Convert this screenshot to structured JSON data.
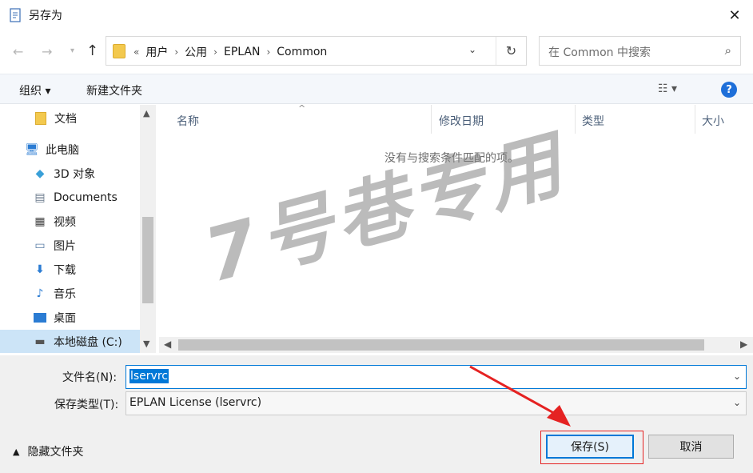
{
  "window": {
    "title": "另存为",
    "close_icon": "close-icon"
  },
  "address": {
    "overflow": "«",
    "crumbs": [
      "用户",
      "公用",
      "EPLAN",
      "Common"
    ]
  },
  "search": {
    "placeholder": "在 Common 中搜索"
  },
  "toolbar": {
    "organize_label": "组织 ▾",
    "new_folder_label": "新建文件夹",
    "view_label": "☷ ▾",
    "help_label": "?"
  },
  "navpane": {
    "items": [
      {
        "label": "文档",
        "icon": "folder-icon"
      },
      {
        "label": "此电脑",
        "icon": "computer-icon"
      },
      {
        "label": "3D 对象",
        "icon": "cube-icon"
      },
      {
        "label": "Documents",
        "icon": "document-icon"
      },
      {
        "label": "视频",
        "icon": "video-icon"
      },
      {
        "label": "图片",
        "icon": "picture-icon"
      },
      {
        "label": "下载",
        "icon": "download-icon"
      },
      {
        "label": "音乐",
        "icon": "music-icon"
      },
      {
        "label": "桌面",
        "icon": "desktop-icon"
      },
      {
        "label": "本地磁盘 (C:)",
        "icon": "drive-icon"
      }
    ]
  },
  "filelist": {
    "columns": [
      "名称",
      "修改日期",
      "类型",
      "大小"
    ],
    "empty_message": "没有与搜索条件匹配的项。"
  },
  "watermark": "7号巷专用",
  "form": {
    "filename_label": "文件名(N):",
    "filename_value": "lservrc",
    "filetype_label": "保存类型(T):",
    "filetype_value": "EPLAN License (lservrc)"
  },
  "footer": {
    "hide_folders_label": "隐藏文件夹",
    "save_label": "保存(S)",
    "cancel_label": "取消"
  },
  "colors": {
    "accent": "#0078d7",
    "annotation": "#e52222"
  }
}
